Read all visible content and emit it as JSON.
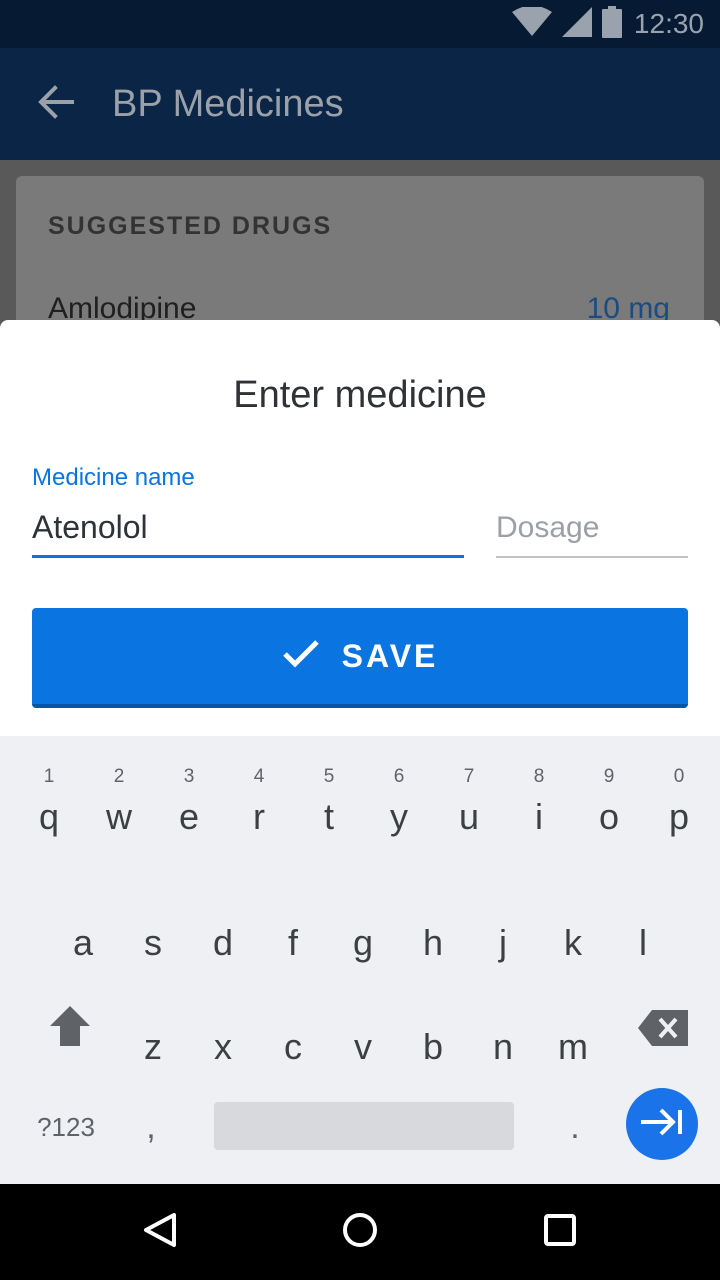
{
  "status_bar": {
    "time": "12:30",
    "icons": [
      "wifi-icon",
      "signal-icon",
      "battery-icon"
    ]
  },
  "app_bar": {
    "title": "BP Medicines",
    "back_icon": "arrow-back-icon"
  },
  "card": {
    "label": "SUGGESTED DRUGS",
    "drug_name": "Amlodipine",
    "dose": "10 mg"
  },
  "sheet": {
    "title": "Enter medicine",
    "medicine_label": "Medicine name",
    "medicine_value": "Atenolol",
    "dosage_placeholder": "Dosage",
    "save_label": "SAVE",
    "save_icon": "check-icon"
  },
  "keyboard": {
    "row1": [
      {
        "hint": "1",
        "ch": "q"
      },
      {
        "hint": "2",
        "ch": "w"
      },
      {
        "hint": "3",
        "ch": "e"
      },
      {
        "hint": "4",
        "ch": "r"
      },
      {
        "hint": "5",
        "ch": "t"
      },
      {
        "hint": "6",
        "ch": "y"
      },
      {
        "hint": "7",
        "ch": "u"
      },
      {
        "hint": "8",
        "ch": "i"
      },
      {
        "hint": "9",
        "ch": "o"
      },
      {
        "hint": "0",
        "ch": "p"
      }
    ],
    "row2": [
      "a",
      "s",
      "d",
      "f",
      "g",
      "h",
      "j",
      "k",
      "l"
    ],
    "row3": [
      "z",
      "x",
      "c",
      "v",
      "b",
      "n",
      "m"
    ],
    "symbols_label": "?123",
    "comma": ",",
    "period": ".",
    "icons": [
      "shift-icon",
      "backspace-icon",
      "enter-icon"
    ]
  },
  "nav_bar": {
    "icons": [
      "back-triangle-icon",
      "home-circle-icon",
      "recents-square-icon"
    ]
  },
  "colors": {
    "primary": "#0a74e0",
    "app_bar": "#0a2546",
    "status_bar": "#061a33"
  }
}
